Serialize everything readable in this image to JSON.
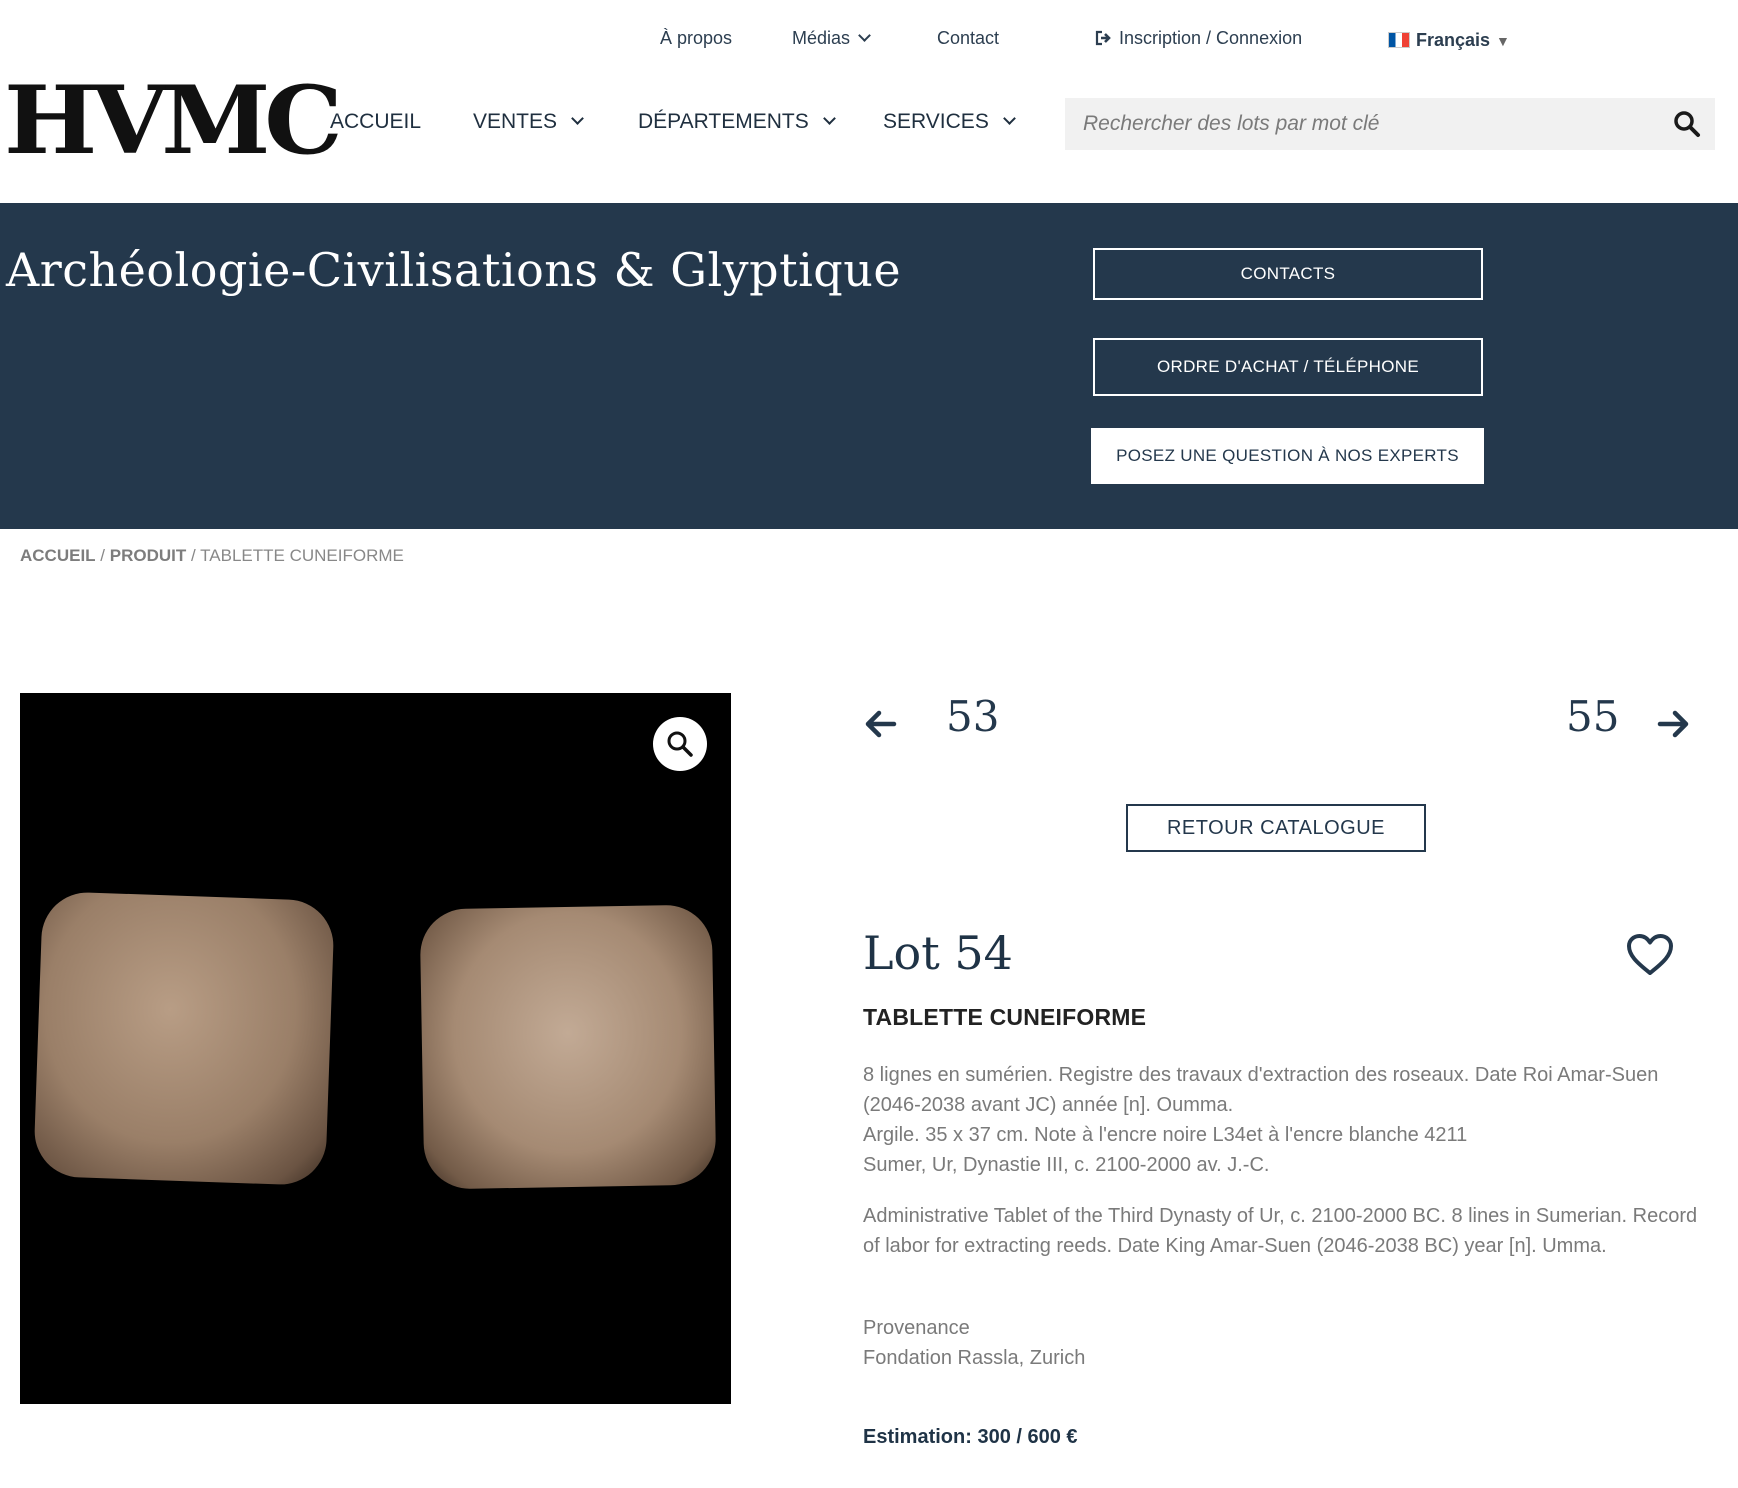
{
  "top_bar": {
    "about": "À propos",
    "media": "Médias",
    "contact": "Contact",
    "login": "Inscription / Connexion",
    "language": "Français"
  },
  "logo": {
    "text": "HVMC"
  },
  "nav": {
    "home": "ACCUEIL",
    "sales": "VENTES",
    "departments": "DÉPARTEMENTS",
    "services": "SERVICES"
  },
  "search": {
    "placeholder": "Rechercher des lots par mot clé"
  },
  "hero": {
    "title": "Archéologie-Civilisations & Glyptique",
    "btn_contacts": "CONTACTS",
    "btn_order": "ORDRE D'ACHAT / TÉLÉPHONE",
    "btn_question": "POSEZ UNE QUESTION À NOS EXPERTS"
  },
  "breadcrumb": {
    "home": "ACCUEIL",
    "sep1": "/",
    "product": "PRODUIT",
    "sep2": "/",
    "current": "TABLETTE CUNEIFORME"
  },
  "lot_nav": {
    "prev": "53",
    "next": "55",
    "back": "RETOUR CATALOGUE"
  },
  "lot": {
    "title": "Lot 54",
    "name": "TABLETTE CUNEIFORME",
    "desc_fr_1": "8 lignes en sumérien. Registre des travaux d'extraction des roseaux. Date Roi Amar-Suen (2046-2038 avant JC) année [n]. Oumma.",
    "desc_fr_2": "Argile. 35 x 37 cm. Note à l'encre noire L34et à l'encre blanche 4211",
    "desc_fr_3": "Sumer, Ur, Dynastie III, c. 2100-2000 av. J.-C.",
    "desc_en": "Administrative Tablet of the Third Dynasty of Ur, c. 2100-2000 BC. 8 lines in Sumerian. Record of labor for extracting reeds. Date King Amar-Suen (2046-2038 BC) year [n]. Umma.",
    "provenance_label": "Provenance",
    "provenance_value": "Fondation Rassla, Zurich",
    "estimation": "Estimation: 300 / 600 €"
  },
  "icons": [
    "sign-in-icon",
    "france-flag-icon",
    "search-icon",
    "zoom-icon",
    "arrow-left-icon",
    "arrow-right-icon",
    "heart-icon"
  ],
  "colors": {
    "navy": "#24384c",
    "text_gray": "#7a7a7a",
    "search_bg": "#f1f1f1"
  }
}
